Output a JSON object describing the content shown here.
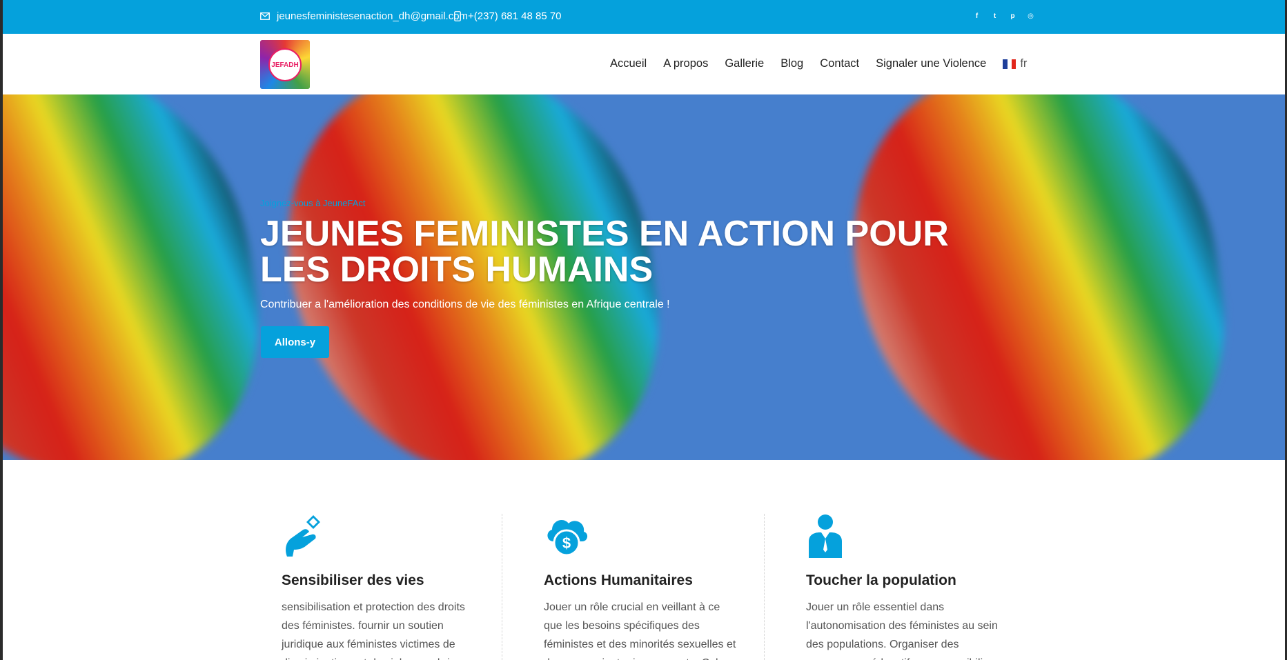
{
  "topbar": {
    "email": "jeunesfeministesenaction_dh@gmail.com",
    "phone": "+(237) 681 48 85 70",
    "social": [
      {
        "icon": "facebook-icon",
        "glyph": "f"
      },
      {
        "icon": "twitter-icon",
        "glyph": "t"
      },
      {
        "icon": "pinterest-icon",
        "glyph": "p"
      },
      {
        "icon": "instagram-icon",
        "glyph": "◎"
      }
    ]
  },
  "header": {
    "logo_text": "JEFADH",
    "nav": [
      "Accueil",
      "A propos",
      "Gallerie",
      "Blog",
      "Contact",
      "Signaler une Violence"
    ],
    "lang": "fr"
  },
  "hero": {
    "kicker": "Joignez-vous à JeuneFAct",
    "title": "JEUNES FEMINISTES EN ACTION POUR LES DROITS HUMAINS",
    "subtitle": "Contribuer a l'amélioration des conditions de vie des féministes en Afrique centrale !",
    "cta": "Allons-y"
  },
  "features": [
    {
      "icon": "hand-heart-icon",
      "title": "Sensibiliser des vies",
      "text": "sensibilisation et protection des droits des féministes. fournir un soutien juridique aux féministes victimes de discriminations et de violences, briser"
    },
    {
      "icon": "cloud-dollar-icon",
      "title": "Actions Humanitaires",
      "text": "Jouer un rôle crucial en veillant à ce que les besoins spécifiques des féministes et des minorités sexuelles et de genre soient pris en compte. Cela inclut la"
    },
    {
      "icon": "person-suit-icon",
      "title": "Toucher la population",
      "text": "Jouer un rôle essentiel dans l'autonomisation des féministes au sein des populations. Organiser des programmes éducatifs pour sensibiliser"
    }
  ],
  "colors": {
    "accent": "#05a1dc",
    "hero_bg": "#4a86d8"
  }
}
